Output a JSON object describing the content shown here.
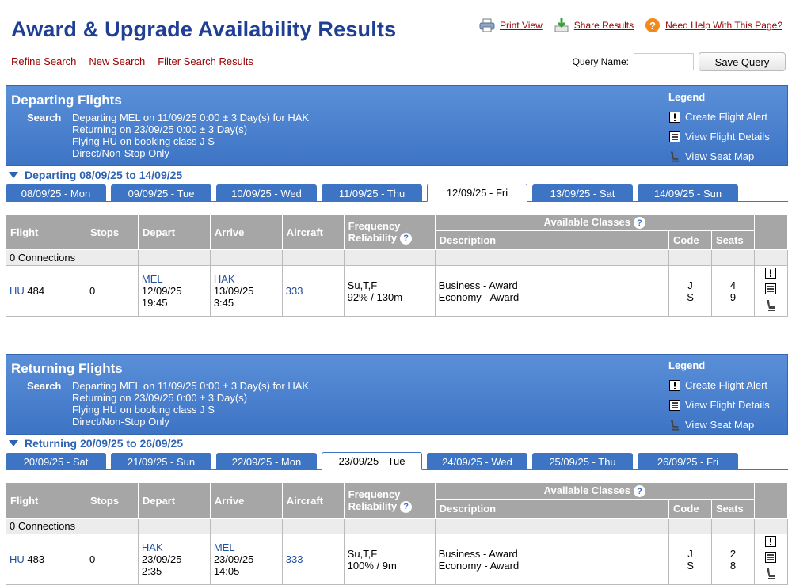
{
  "header": {
    "title": "Award & Upgrade Availability Results",
    "print_view": "Print View",
    "share_results": "Share Results",
    "need_help": "Need Help With This Page?"
  },
  "subnav": {
    "refine": "Refine Search",
    "new": "New Search",
    "filter": "Filter Search Results"
  },
  "query": {
    "label": "Query Name:",
    "value": "",
    "save": "Save Query"
  },
  "legend": {
    "title": "Legend",
    "alert": "Create Flight Alert",
    "details": "View Flight Details",
    "seat": "View Seat Map"
  },
  "columns": {
    "flight": "Flight",
    "stops": "Stops",
    "depart": "Depart",
    "arrive": "Arrive",
    "aircraft": "Aircraft",
    "frequency": "Frequency",
    "reliability": "Reliability",
    "available": "Available Classes",
    "description": "Description",
    "code": "Code",
    "seats": "Seats"
  },
  "search": {
    "label": "Search",
    "line1": "Departing MEL on 11/09/25 0:00 ± 3 Day(s) for HAK",
    "line2": "Returning on 23/09/25 0:00 ± 3 Day(s)",
    "line3": "Flying HU on booking class J S",
    "line4": "Direct/Non-Stop Only"
  },
  "departing": {
    "heading": "Departing Flights",
    "range": "Departing 08/09/25 to 14/09/25",
    "tabs": [
      "08/09/25 - Mon",
      "09/09/25 - Tue",
      "10/09/25 - Wed",
      "11/09/25 - Thu",
      "12/09/25 - Fri",
      "13/09/25 - Sat",
      "14/09/25 - Sun"
    ],
    "active_tab": 4,
    "connections": "0 Connections",
    "flight": {
      "carrier": "HU",
      "number": "484",
      "stops": "0",
      "dep_code": "MEL",
      "dep_date": "12/09/25",
      "dep_time": "19:45",
      "arr_code": "HAK",
      "arr_date": "13/09/25",
      "arr_time": "3:45",
      "aircraft": "333",
      "frequency": "Su,T,F",
      "reliability": "92% / 130m",
      "classes": [
        {
          "desc": "Business - Award",
          "code": "J",
          "seats": "4"
        },
        {
          "desc": "Economy - Award",
          "code": "S",
          "seats": "9"
        }
      ]
    }
  },
  "returning": {
    "heading": "Returning Flights",
    "range": "Returning 20/09/25 to 26/09/25",
    "tabs": [
      "20/09/25 - Sat",
      "21/09/25 - Sun",
      "22/09/25 - Mon",
      "23/09/25 - Tue",
      "24/09/25 - Wed",
      "25/09/25 - Thu",
      "26/09/25 - Fri"
    ],
    "active_tab": 3,
    "connections": "0 Connections",
    "flight": {
      "carrier": "HU",
      "number": "483",
      "stops": "0",
      "dep_code": "HAK",
      "dep_date": "23/09/25",
      "dep_time": "2:35",
      "arr_code": "MEL",
      "arr_date": "23/09/25",
      "arr_time": "14:05",
      "aircraft": "333",
      "frequency": "Su,T,F",
      "reliability": "100% / 9m",
      "classes": [
        {
          "desc": "Business - Award",
          "code": "J",
          "seats": "2"
        },
        {
          "desc": "Economy - Award",
          "code": "S",
          "seats": "8"
        }
      ]
    }
  }
}
